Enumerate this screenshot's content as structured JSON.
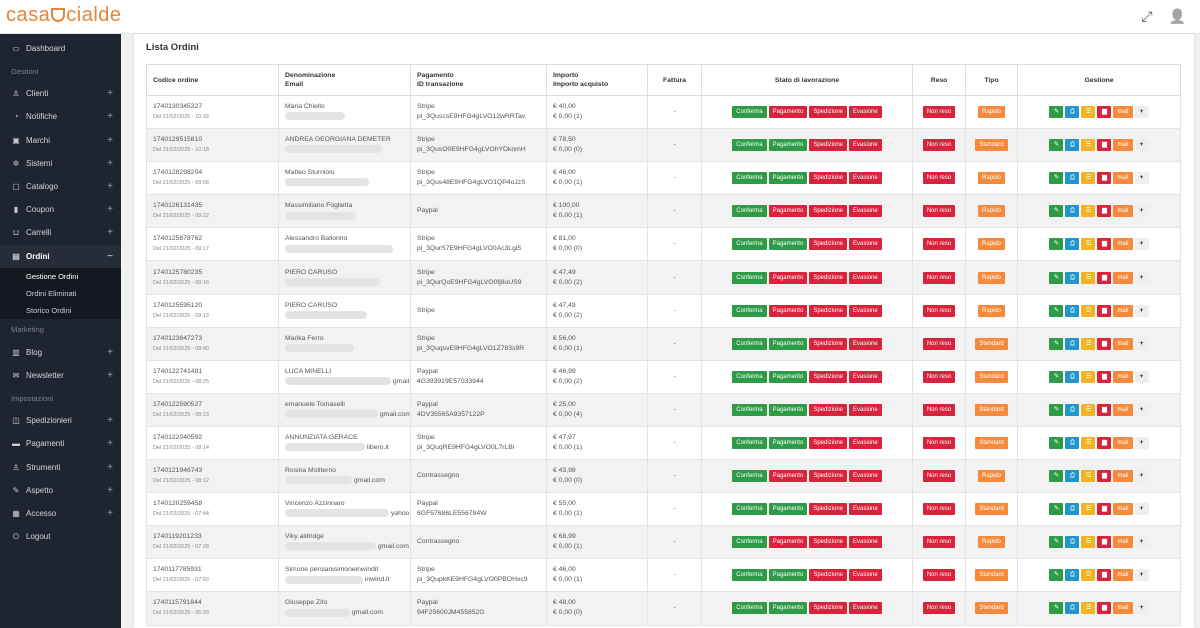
{
  "app": {
    "logo_left": "casa",
    "logo_right": "cialde"
  },
  "topbar": {
    "expand_icon": "⤢",
    "user_icon": "👤"
  },
  "sidebar": {
    "dashboard": "Dashboard",
    "section_gestioni": "Gestioni",
    "clienti": "Clienti",
    "notifiche": "Notifiche",
    "marchi": "Marchi",
    "sistemi": "Sistemi",
    "catalogo": "Catalogo",
    "coupon": "Coupon",
    "carrelli": "Carrelli",
    "ordini": "Ordini",
    "gestione_ordini": "Gestione Ordini",
    "ordini_eliminati": "Ordini Eliminati",
    "storico_ordini": "Storico Ordini",
    "section_marketing": "Marketing",
    "blog": "Blog",
    "newsletter": "Newsletter",
    "section_impostazioni": "Impostazioni",
    "spedizionieri": "Spedizionieri",
    "pagamenti": "Pagamenti",
    "strumenti": "Strumenti",
    "aspetto": "Aspetto",
    "accesso": "Accesso",
    "logout": "Logout",
    "plus": "+",
    "minus": "−"
  },
  "page": {
    "title": "Lista Ordini"
  },
  "table": {
    "headers": {
      "codice": "Codice ordine",
      "denominazione": "Denominazione",
      "email": "Email",
      "pagamento": "Pagamento",
      "id_transazione": "ID transazione",
      "importo": "Importo",
      "importo_acquisto": "Importo acquisto",
      "fattura": "Fattura",
      "stato": "Stato di lavorazione",
      "reso": "Reso",
      "tipo": "Tipo",
      "gestione": "Gestione"
    },
    "labels": {
      "conferma": "Conferma",
      "pagamento": "Pagamento",
      "spedizione": "Spedizione",
      "evasione": "Evasione",
      "non_reso": "Non reso",
      "mail": "mail",
      "dash": "-"
    },
    "rows": [
      {
        "code": "1740130345327",
        "date": "Del 21/02/2025 - 10:32",
        "name": "Maria Chiello",
        "email": "",
        "pay": "Stripe",
        "tx": "pi_3QuscsE9HFG4gLVO12wRRTav",
        "amount": "€ 40,00",
        "purchase": "€ 0,00 (1)",
        "tipo": "Rapido",
        "pag_green": false
      },
      {
        "code": "1740129515810",
        "date": "Del 21/02/2025 - 10:18",
        "name": "ANDREA GEORGIANA DEMETER",
        "email": "",
        "pay": "Stripe",
        "tx": "pi_3QusO0E9HFG4gLVOhYDknmH",
        "amount": "€ 78,50",
        "purchase": "€ 0,00 (0)",
        "tipo": "Standard",
        "pag_green": true
      },
      {
        "code": "1740128298204",
        "date": "Del 21/02/2025 - 09:58",
        "name": "Matteo Sturniolo",
        "email": "",
        "pay": "Stripe",
        "tx": "pi_3Qus48E9HFG4gLVO1QP4oJzS",
        "amount": "€ 46,00",
        "purchase": "€ 0,00 (1)",
        "tipo": "Rapido",
        "pag_green": true
      },
      {
        "code": "1740126131435",
        "date": "Del 21/02/2025 - 09:22",
        "name": "Massimiliano Foglietta",
        "email": "",
        "pay": "Paypal",
        "tx": "",
        "amount": "€ 100,00",
        "purchase": "€ 0,00 (1)",
        "tipo": "Rapido",
        "pag_green": false
      },
      {
        "code": "1740125878762",
        "date": "Del 21/02/2025 - 09:17",
        "name": "Alessandro Ballorino",
        "email": "",
        "pay": "Stripe",
        "tx": "pi_3QurS7E9HFG4gLVO0Ac3Lgi5",
        "amount": "€ 81,00",
        "purchase": "€ 0,00 (0)",
        "tipo": "Rapido",
        "pag_green": true
      },
      {
        "code": "1740125780235",
        "date": "Del 21/02/2025 - 09:16",
        "name": "PIERO CARUSO",
        "email": "",
        "pay": "Stripe",
        "tx": "pi_3QurQoE9HFG4gLVO0fj8uUS9",
        "amount": "€ 47,49",
        "purchase": "€ 0,00 (2)",
        "tipo": "Rapido",
        "pag_green": false
      },
      {
        "code": "1740125595120",
        "date": "Del 21/02/2025 - 09:13",
        "name": "PIERO CARUSO",
        "email": "",
        "pay": "Stripe",
        "tx": "",
        "amount": "€ 47,49",
        "purchase": "€ 0,00 (2)",
        "tipo": "Rapido",
        "pag_green": false
      },
      {
        "code": "1740123647273",
        "date": "Del 21/02/2025 - 08:40",
        "name": "Marika Ferro",
        "email": "",
        "pay": "Stripe",
        "tx": "pi_3QuqsvE9HFG4gLVO1Z783s9R",
        "amount": "€ 56,00",
        "purchase": "€ 0,00 (1)",
        "tipo": "Standard",
        "pag_green": true
      },
      {
        "code": "1740122741481",
        "date": "Del 21/02/2025 - 08:25",
        "name": "LUCA MINELLI",
        "email": "gmail.com",
        "pay": "Paypal",
        "tx": "4G393919E57033944",
        "amount": "€ 46,99",
        "purchase": "€ 0,00 (2)",
        "tipo": "Standard",
        "pag_green": true
      },
      {
        "code": "1740122590527",
        "date": "Del 21/02/2025 - 08:23",
        "name": "emanuele Tomaselli",
        "email": "gmail.com",
        "pay": "Paypal",
        "tx": "4DV35565A9357122P",
        "amount": "€ 25,00",
        "purchase": "€ 0,00 (4)",
        "tipo": "Standard",
        "pag_green": true
      },
      {
        "code": "1740122040592",
        "date": "Del 21/02/2025 - 08:14",
        "name": "ANNUNZIATA GERACE",
        "email": "libero.it",
        "pay": "Stripe",
        "tx": "pi_3QuqRE9HFG4gLVO0L7rLBl",
        "amount": "€ 47,97",
        "purchase": "€ 0,00 (1)",
        "tipo": "Standard",
        "pag_green": true
      },
      {
        "code": "1740121946743",
        "date": "Del 21/02/2025 - 08:12",
        "name": "Rosina Moliterno",
        "email": "gmail.com",
        "pay": "Contrassegno",
        "tx": "",
        "amount": "€ 43,98",
        "purchase": "€ 0,00 (0)",
        "tipo": "Rapido",
        "pag_green": false
      },
      {
        "code": "1740120259458",
        "date": "Del 21/02/2025 - 07:44",
        "name": "Vincenzo Azzinnaro",
        "email": "yahoo.it",
        "pay": "Paypal",
        "tx": "6GF57686LE556784W",
        "amount": "€ 55,00",
        "purchase": "€ 0,00 (1)",
        "tipo": "Standard",
        "pag_green": true
      },
      {
        "code": "1740119201233",
        "date": "Del 21/02/2025 - 07:28",
        "name": "Viky aldridge",
        "email": "gmail.com",
        "pay": "Contrassegno",
        "tx": "",
        "amount": "€ 68,99",
        "purchase": "€ 0,00 (1)",
        "tipo": "Rapido",
        "pag_green": false
      },
      {
        "code": "1740117785931",
        "date": "Del 21/02/2025 - 07:03",
        "name": "Simone persianisimoneinwindit",
        "email": "inwind.it",
        "pay": "Stripe",
        "tx": "pi_3QupkKE9HFG4gLVO0PBOHxc9",
        "amount": "€ 46,00",
        "purchase": "€ 0,00 (1)",
        "tipo": "Standard",
        "pag_green": true
      },
      {
        "code": "1740115791844",
        "date": "Del 21/02/2025 - 06:29",
        "name": "Giuseppe Zito",
        "email": "gmail.com",
        "pay": "Paypal",
        "tx": "94F25600JM455852G",
        "amount": "€ 48,00",
        "purchase": "€ 0,00 (0)",
        "tipo": "Standard",
        "pag_green": true
      }
    ]
  },
  "colors": {
    "green": "#2e9b47",
    "red": "#d9223b",
    "orange": "#f58a3c",
    "blue": "#2197c9",
    "yellow": "#f2b324",
    "sidebar": "#1f2530"
  },
  "icons": {
    "edit": "edit-icon",
    "print": "print-icon",
    "list": "list-icon",
    "delete": "trash-icon",
    "add": "plus-icon"
  }
}
